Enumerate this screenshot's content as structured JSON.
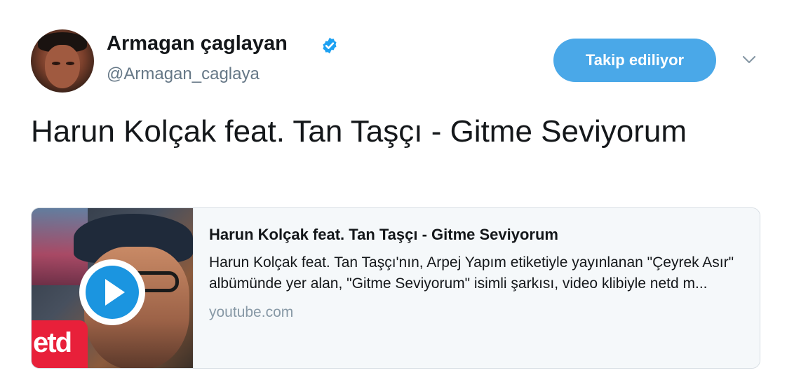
{
  "author": {
    "name": "Armagan çaglayan",
    "handle": "@Armagan_caglaya",
    "verified_icon": "verified-badge-icon",
    "verified_color": "#1da1f2"
  },
  "follow_button": {
    "label": "Takip ediliyor",
    "color": "#4aa8e8"
  },
  "menu_icon": "chevron-down-icon",
  "tweet": {
    "text": "Harun Kolçak feat. Tan Taşçı - Gitme Seviyorum"
  },
  "card": {
    "title": "Harun Kolçak feat. Tan Taşçı - Gitme Seviyorum",
    "description": "Harun Kolçak feat. Tan Taşçı'nın, Arpej Yapım etiketiyle yayınlanan \"Çeyrek Asır\" albümünde yer alan, \"Gitme Seviyorum\" isimli şarkısı, video klibiyle netd m...",
    "domain": "youtube.com",
    "thumbnail_logo": "etd",
    "play_icon": "play-icon"
  }
}
